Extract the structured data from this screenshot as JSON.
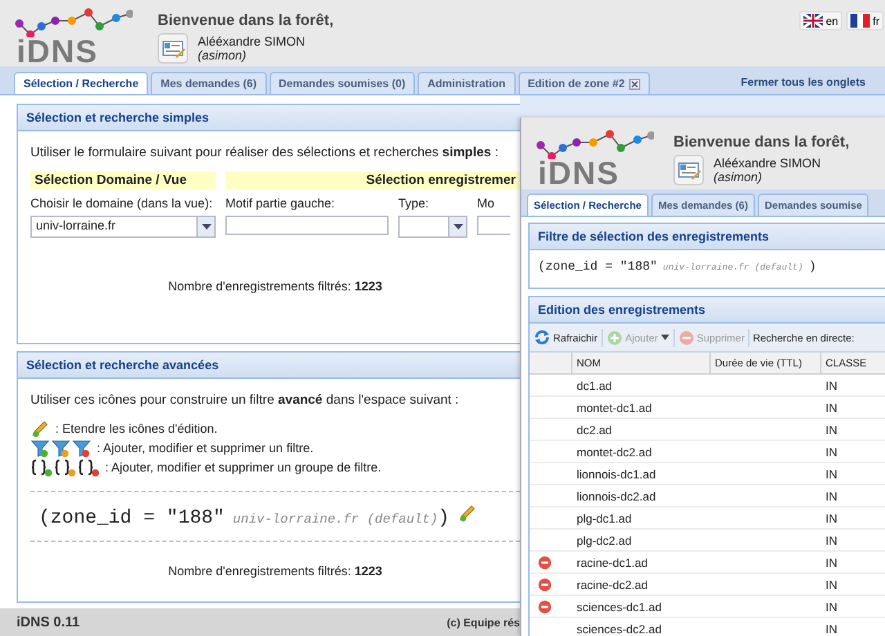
{
  "header": {
    "logo": "iDNS",
    "welcome": "Bienvenue dans la forêt,",
    "user_name": "Alééxandre SIMON",
    "user_login": "(asimon)",
    "languages": [
      {
        "label": "en",
        "kind": "gb"
      },
      {
        "label": "fr",
        "kind": "fr"
      }
    ]
  },
  "tabs": [
    {
      "label": "Sélection / Recherche",
      "selected": true,
      "closable": false
    },
    {
      "label": "Mes demandes (6)",
      "selected": false,
      "closable": false
    },
    {
      "label": "Demandes soumises (0)",
      "selected": false,
      "closable": false
    },
    {
      "label": "Administration",
      "selected": false,
      "closable": false
    },
    {
      "label": "Edition de zone #2",
      "selected": false,
      "closable": true
    }
  ],
  "close_all": "Fermer tous les onglets",
  "simple": {
    "title": "Sélection et recherche simples",
    "intro": "Utiliser le formulaire suivant pour réaliser des sélections et recherches **simples** :",
    "section_domain": "Sélection Domaine / Vue",
    "section_records": "Sélection enregistremer",
    "fields": [
      {
        "label": "Choisir le domaine (dans la vue):",
        "kind": "select",
        "value": "univ-lorraine.fr"
      },
      {
        "label": "Motif partie gauche:",
        "kind": "text"
      },
      {
        "label": "Type:",
        "kind": "select"
      },
      {
        "label": "Mo",
        "kind": "text"
      }
    ],
    "count": "Nombre d'enregistrements filtrés: **1223**"
  },
  "advanced": {
    "title": "Sélection et recherche avancées",
    "intro": "Utiliser ces icônes pour construire un filtre **avancé** dans l'espace suivant :",
    "legend": [
      {
        "kind": "pencil",
        "text": ": Etendre les icônes d'édition."
      },
      {
        "kind": "filters",
        "text": ": Ajouter, modifier et supprimer un filtre."
      },
      {
        "kind": "groups",
        "text": ": Ajouter, modifier et supprimer un groupe de filtre."
      }
    ],
    "expression": "(zone_id = \"188\"",
    "hint": "univ-lorraine.fr (default)",
    "close": ")",
    "count": "Nombre d'enregistrements filtrés: **1223**"
  },
  "footer": {
    "version": "iDNS 0.11",
    "credit": "(c) Equipe rés"
  },
  "overlay": {
    "logo": "iDNS",
    "welcome": "Bienvenue dans la forêt,",
    "user_name": "Alééxandre SIMON",
    "user_login": "(asimon)",
    "tabs": [
      {
        "label": "Sélection / Recherche",
        "selected": true
      },
      {
        "label": "Mes demandes (6)",
        "selected": false
      },
      {
        "label": "Demandes soumise",
        "selected": false
      }
    ],
    "filter": {
      "title": "Filtre de sélection des enregistrements",
      "expression": "(zone_id = \"188\"",
      "hint": "univ-lorraine.fr (default)",
      "close": ")"
    },
    "editor": {
      "title": "Edition des enregistrements",
      "toolbar": [
        {
          "kind": "refresh",
          "label": "Rafraichir",
          "disabled": false,
          "menu": false
        },
        {
          "kind": "add",
          "label": "Ajouter",
          "disabled": true,
          "menu": true
        },
        {
          "kind": "delete",
          "label": "Supprimer",
          "disabled": true,
          "menu": false
        }
      ],
      "search_label": "Recherche en directe:",
      "columns": [
        "NOM",
        "Durée de vie (TTL)",
        "CLASSE"
      ],
      "rows": [
        {
          "name": "dc1.ad",
          "class": "IN",
          "deletable": false
        },
        {
          "name": "montet-dc1.ad",
          "class": "IN",
          "deletable": false
        },
        {
          "name": "dc2.ad",
          "class": "IN",
          "deletable": false
        },
        {
          "name": "montet-dc2.ad",
          "class": "IN",
          "deletable": false
        },
        {
          "name": "lionnois-dc1.ad",
          "class": "IN",
          "deletable": false
        },
        {
          "name": "lionnois-dc2.ad",
          "class": "IN",
          "deletable": false
        },
        {
          "name": "plg-dc1.ad",
          "class": "IN",
          "deletable": false
        },
        {
          "name": "plg-dc2.ad",
          "class": "IN",
          "deletable": false
        },
        {
          "name": "racine-dc1.ad",
          "class": "IN",
          "deletable": true
        },
        {
          "name": "racine-dc2.ad",
          "class": "IN",
          "deletable": true
        },
        {
          "name": "sciences-dc1.ad",
          "class": "IN",
          "deletable": true
        },
        {
          "name": "sciences-dc2.ad",
          "class": "IN",
          "deletable": false
        }
      ]
    }
  }
}
